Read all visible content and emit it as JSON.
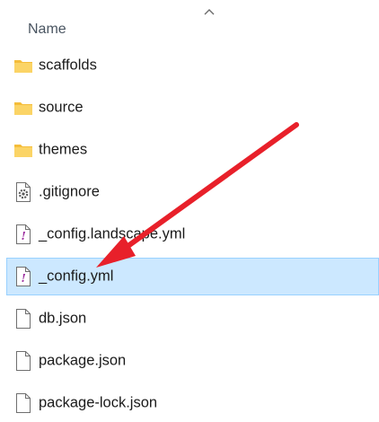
{
  "header": {
    "column_name": "Name"
  },
  "files": [
    {
      "name": "scaffolds",
      "icon": "folder-icon",
      "selected": false
    },
    {
      "name": "source",
      "icon": "folder-icon",
      "selected": false
    },
    {
      "name": "themes",
      "icon": "folder-icon",
      "selected": false
    },
    {
      "name": ".gitignore",
      "icon": "settings-file-icon",
      "selected": false
    },
    {
      "name": "_config.landscape.yml",
      "icon": "yaml-file-icon",
      "selected": false
    },
    {
      "name": "_config.yml",
      "icon": "yaml-file-icon",
      "selected": true
    },
    {
      "name": "db.json",
      "icon": "document-icon",
      "selected": false
    },
    {
      "name": "package.json",
      "icon": "document-icon",
      "selected": false
    },
    {
      "name": "package-lock.json",
      "icon": "document-icon",
      "selected": false
    }
  ],
  "colors": {
    "selection_bg": "#cce8ff",
    "selection_border": "#99d1ff",
    "annotation_arrow": "#e8202a",
    "folder": "#f8c94a"
  }
}
